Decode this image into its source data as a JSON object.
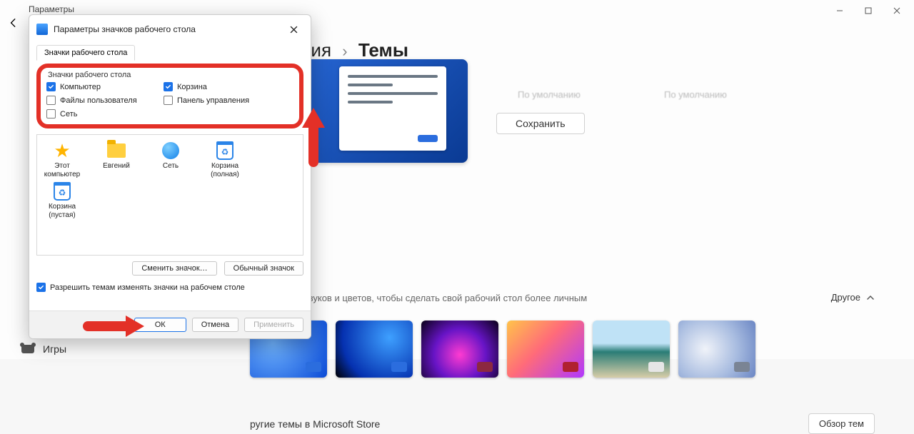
{
  "bg": {
    "back_title": "Параметры",
    "breadcrumb_left": "ализация",
    "breadcrumb_sep": "›",
    "breadcrumb_right": "Темы",
    "save": "Сохранить",
    "placeholders": [
      "По умолчанию",
      "По умолчанию"
    ],
    "section_desc": "ание обоев, звуков и цветов, чтобы сделать свой рабочий стол более личным",
    "other": "Другое",
    "store_label": "ругие темы в Microsoft Store",
    "overview": "Обзор тем",
    "sidebar_games": "Игры"
  },
  "dialog": {
    "title": "Параметры значков рабочего стола",
    "tab": "Значки рабочего стола",
    "group_title": "Значки рабочего стола",
    "checks": {
      "computer": {
        "label": "Компьютер",
        "checked": true
      },
      "recycle": {
        "label": "Корзина",
        "checked": true
      },
      "userfiles": {
        "label": "Файлы пользователя",
        "checked": false
      },
      "cpanel": {
        "label": "Панель управления",
        "checked": false
      },
      "network": {
        "label": "Сеть",
        "checked": false
      }
    },
    "icons": {
      "this_pc": "Этот компьютер",
      "evgeniy": "Евгений",
      "net": "Сеть",
      "bin_full": "Корзина (полная)",
      "bin_empty": "Корзина (пустая)"
    },
    "change_icon": "Сменить значок…",
    "default_icon": "Обычный значок",
    "allow_themes": "Разрешить темам изменять значки на рабочем столе",
    "ok": "ОК",
    "cancel": "Отмена",
    "apply": "Применить"
  }
}
